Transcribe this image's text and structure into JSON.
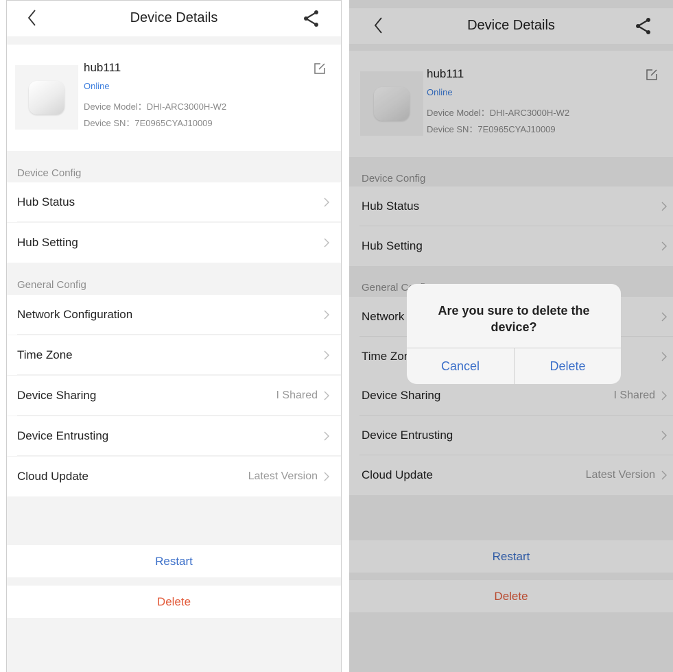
{
  "header": {
    "title": "Device Details"
  },
  "device": {
    "name": "hub111",
    "status": "Online",
    "model": "Device Model：DHI-ARC3000H-W2",
    "sn": "Device SN：7E0965CYAJ10009"
  },
  "sections": {
    "device_config": "Device Config",
    "general_config": "General Config"
  },
  "rows": {
    "hub_status": {
      "label": "Hub Status",
      "value": ""
    },
    "hub_setting": {
      "label": "Hub Setting",
      "value": ""
    },
    "network": {
      "label": "Network Configuration",
      "value": ""
    },
    "time_zone": {
      "label": "Time Zone",
      "value": ""
    },
    "sharing": {
      "label": "Device Sharing",
      "value": "I Shared"
    },
    "entrusting": {
      "label": "Device Entrusting",
      "value": ""
    },
    "cloud_update": {
      "label": "Cloud Update",
      "value": "Latest Version"
    }
  },
  "actions": {
    "restart": "Restart",
    "delete": "Delete"
  },
  "dialog": {
    "message": "Are you sure to delete the device?",
    "cancel": "Cancel",
    "confirm": "Delete"
  },
  "colors": {
    "accent": "#3b6fc9",
    "online": "#3b7ddd",
    "danger": "#e25b3b",
    "background": "#f3f3f3"
  },
  "icons": {
    "back": "chevron-left-icon",
    "share": "share-icon",
    "edit": "edit-icon",
    "chevron": "chevron-right-icon"
  }
}
